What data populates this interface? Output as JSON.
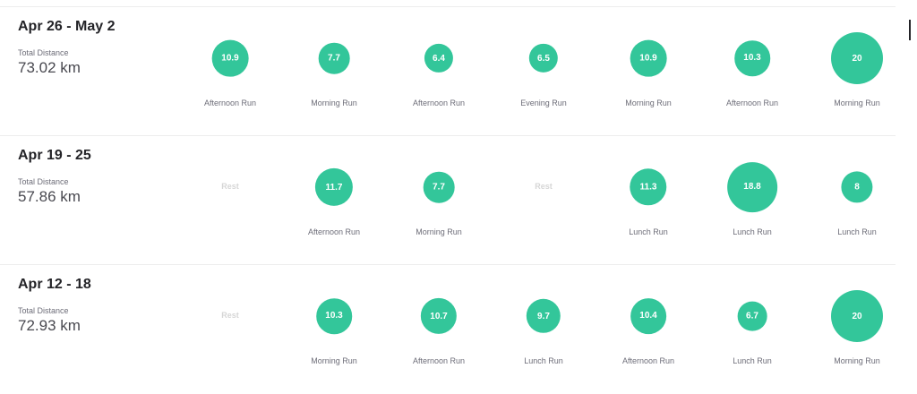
{
  "weeks": [
    {
      "title": "Apr 26 - May 2",
      "distance_label": "Total Distance",
      "distance": "73.02 km",
      "days": [
        {
          "value": "10.9",
          "label": "Afternoon Run",
          "rest": false
        },
        {
          "value": "7.7",
          "label": "Morning Run",
          "rest": false
        },
        {
          "value": "6.4",
          "label": "Afternoon Run",
          "rest": false
        },
        {
          "value": "6.5",
          "label": "Evening Run",
          "rest": false
        },
        {
          "value": "10.9",
          "label": "Morning Run",
          "rest": false
        },
        {
          "value": "10.3",
          "label": "Afternoon Run",
          "rest": false
        },
        {
          "value": "20",
          "label": "Morning Run",
          "rest": false
        }
      ]
    },
    {
      "title": "Apr 19 - 25",
      "distance_label": "Total Distance",
      "distance": "57.86 km",
      "days": [
        {
          "value": "Rest",
          "label": "",
          "rest": true
        },
        {
          "value": "11.7",
          "label": "Afternoon Run",
          "rest": false
        },
        {
          "value": "7.7",
          "label": "Morning Run",
          "rest": false
        },
        {
          "value": "Rest",
          "label": "",
          "rest": true
        },
        {
          "value": "11.3",
          "label": "Lunch Run",
          "rest": false
        },
        {
          "value": "18.8",
          "label": "Lunch Run",
          "rest": false
        },
        {
          "value": "8",
          "label": "Lunch Run",
          "rest": false
        }
      ]
    },
    {
      "title": "Apr 12 - 18",
      "distance_label": "Total Distance",
      "distance": "72.93 km",
      "days": [
        {
          "value": "Rest",
          "label": "",
          "rest": true
        },
        {
          "value": "10.3",
          "label": "Morning Run",
          "rest": false
        },
        {
          "value": "10.7",
          "label": "Afternoon Run",
          "rest": false
        },
        {
          "value": "9.7",
          "label": "Lunch Run",
          "rest": false
        },
        {
          "value": "10.4",
          "label": "Afternoon Run",
          "rest": false
        },
        {
          "value": "6.7",
          "label": "Lunch Run",
          "rest": false
        },
        {
          "value": "20",
          "label": "Morning Run",
          "rest": false
        }
      ]
    }
  ],
  "colors": {
    "bubble": "#33c69a",
    "rest_text": "#d6d6d6"
  }
}
